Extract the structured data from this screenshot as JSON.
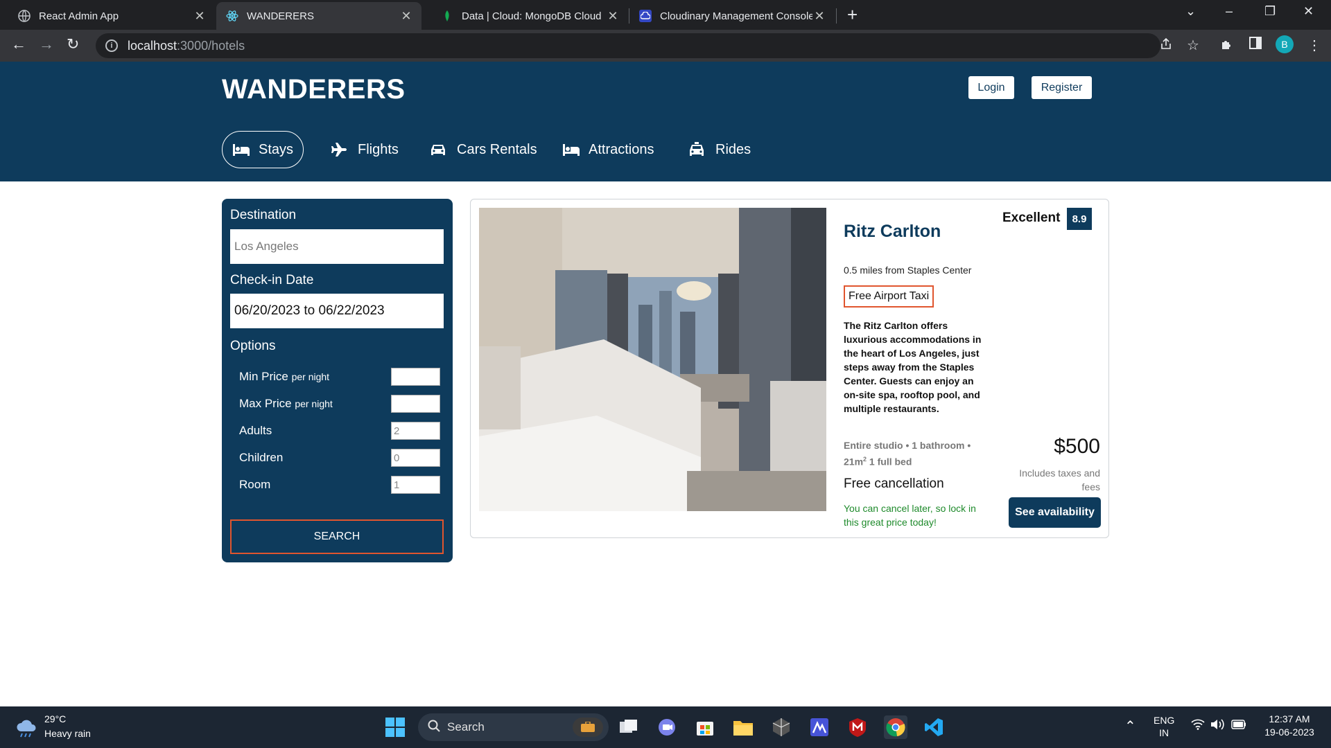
{
  "browser": {
    "tabs": [
      {
        "title": "React Admin App",
        "active": false
      },
      {
        "title": "WANDERERS",
        "active": true
      },
      {
        "title": "Data | Cloud: MongoDB Cloud",
        "active": false
      },
      {
        "title": "Cloudinary Management Console",
        "active": false
      }
    ],
    "url_host": "localhost",
    "url_path": ":3000/hotels",
    "profile_initial": "B"
  },
  "site": {
    "brand": "WANDERERS",
    "login_label": "Login",
    "register_label": "Register",
    "nav": [
      {
        "label": "Stays",
        "icon": "bed-icon",
        "active": true
      },
      {
        "label": "Flights",
        "icon": "plane-icon",
        "active": false
      },
      {
        "label": "Cars Rentals",
        "icon": "car-icon",
        "active": false
      },
      {
        "label": "Attractions",
        "icon": "bed-icon",
        "active": false
      },
      {
        "label": "Rides",
        "icon": "taxi-icon",
        "active": false
      }
    ],
    "colors": {
      "primary": "#0e3b5c",
      "accent": "#e0552e",
      "success": "#1e8a2b"
    }
  },
  "search": {
    "destination_label": "Destination",
    "destination_value": "Los Angeles",
    "checkin_label": "Check-in Date",
    "checkin_value": "06/20/2023 to 06/22/2023",
    "options_label": "Options",
    "options": [
      {
        "label": "Min Price",
        "suffix": "per night",
        "value": ""
      },
      {
        "label": "Max Price",
        "suffix": "per night",
        "value": ""
      },
      {
        "label": "Adults",
        "suffix": "",
        "value": "2"
      },
      {
        "label": "Children",
        "suffix": "",
        "value": "0"
      },
      {
        "label": "Room",
        "suffix": "",
        "value": "1"
      }
    ],
    "button_label": "SEARCH"
  },
  "result": {
    "name": "Ritz Carlton",
    "distance": "0.5 miles from Staples Center",
    "taxi_label": "Free Airport Taxi",
    "description": "The Ritz Carlton offers luxurious accommodations in the heart of Los Angeles, just steps away from the Staples Center. Guests can enjoy an on-site spa, rooftop pool, and multiple restaurants.",
    "features_line1": "Entire studio • 1 bathroom •",
    "features_area": "21m",
    "features_area_sup": "2",
    "features_bed": " 1 full bed",
    "cancellation_title": "Free cancellation",
    "cancellation_sub": "You can cancel later, so lock in this great price today!",
    "rating_text": "Excellent",
    "rating_value": "8.9",
    "price": "$500",
    "tax_note": "Includes taxes and fees",
    "availability_label": "See availability"
  },
  "taskbar": {
    "weather_temp": "29°C",
    "weather_condition": "Heavy rain",
    "search_label": "Search",
    "language_line1": "ENG",
    "language_line2": "IN",
    "time": "12:37 AM",
    "date": "19-06-2023"
  }
}
